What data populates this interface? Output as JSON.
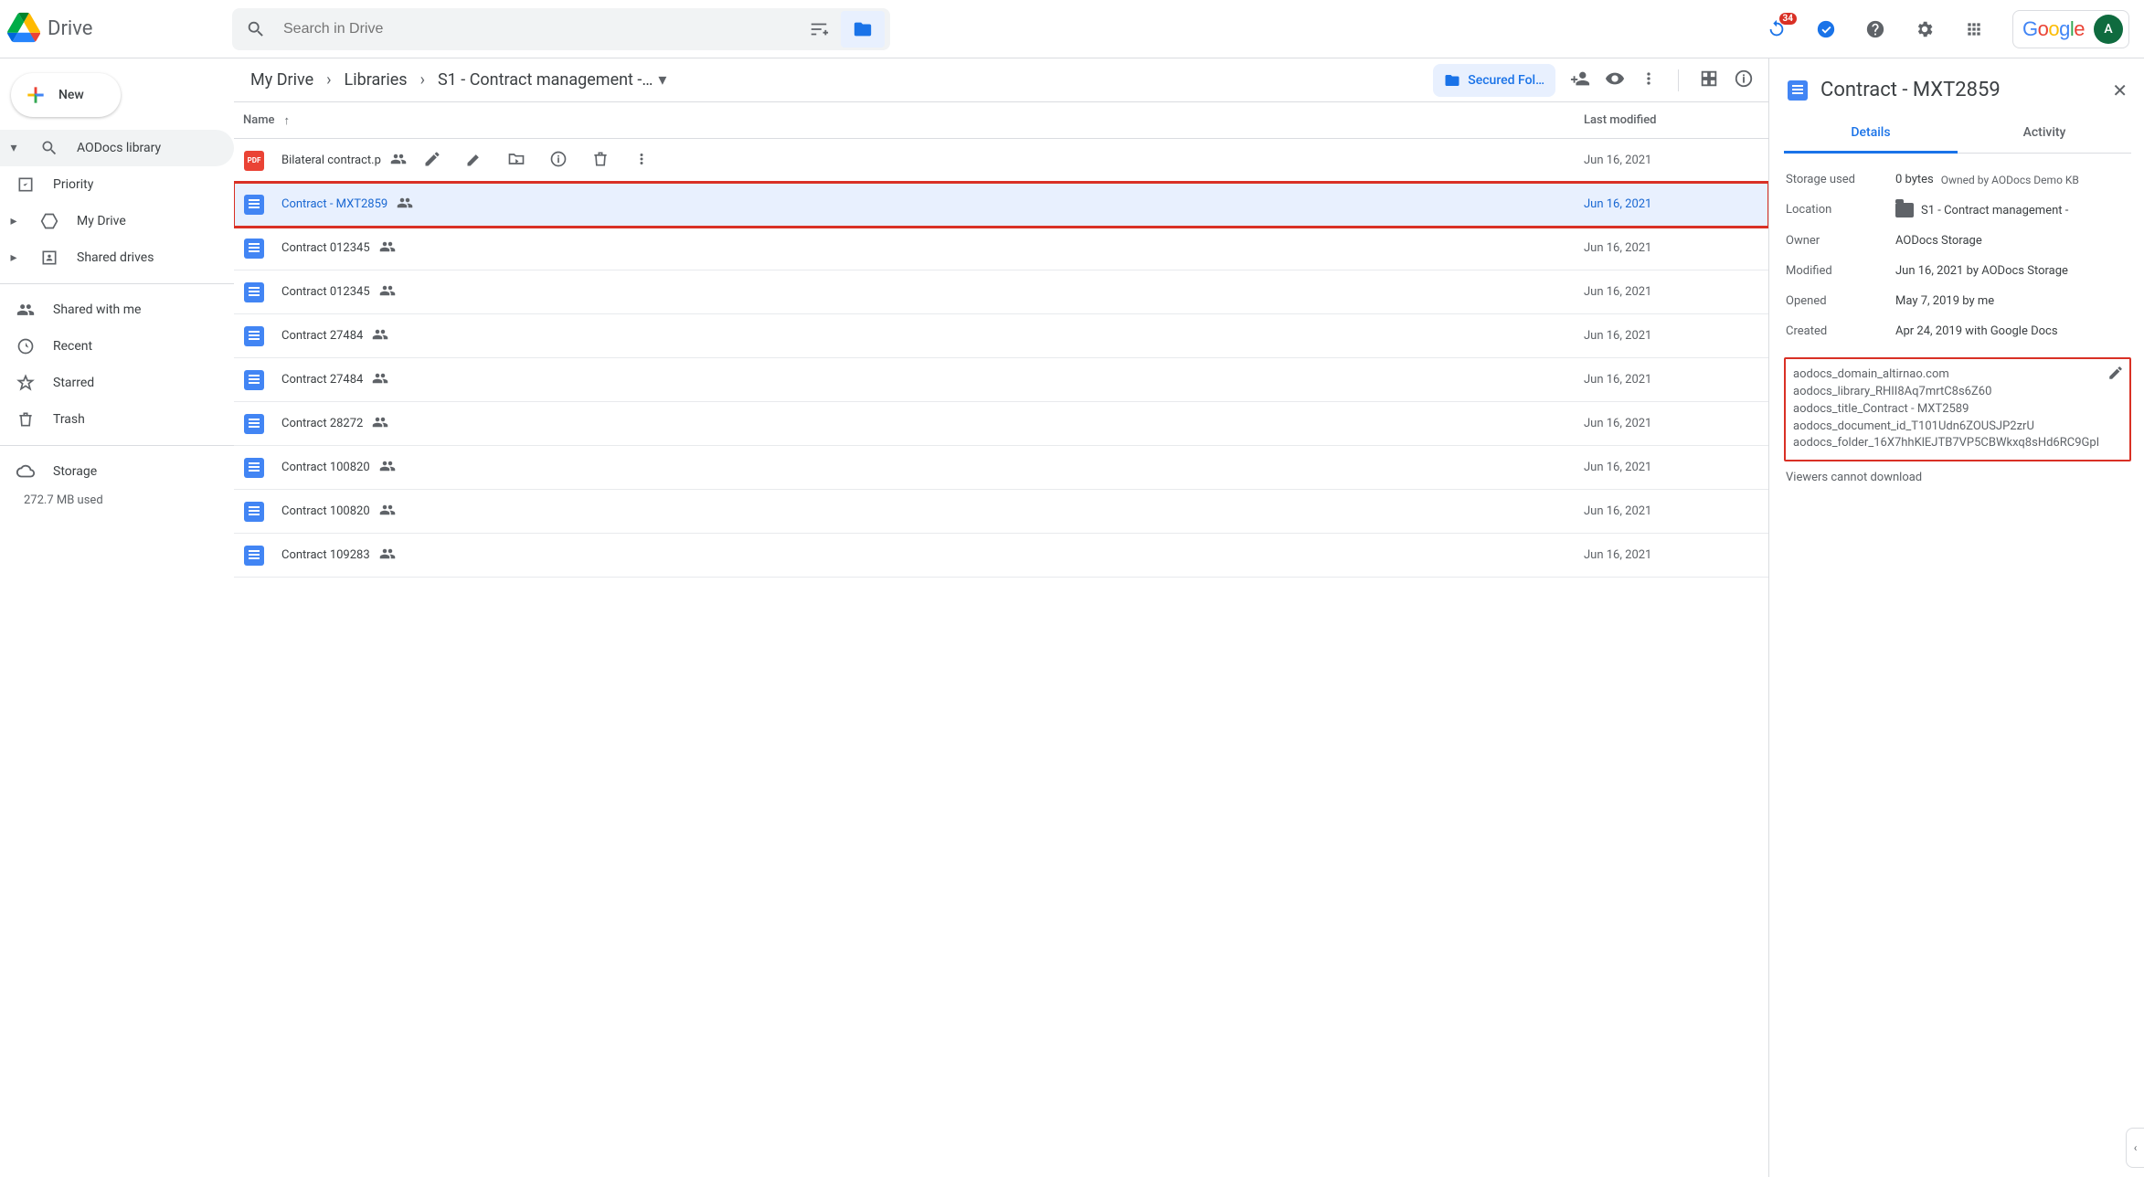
{
  "app": {
    "title": "Drive",
    "google_logo_text": "Google",
    "avatar_initial": "A"
  },
  "search": {
    "placeholder": "Search in Drive"
  },
  "header_badge": "34",
  "sidebar": {
    "new_label": "New",
    "items": [
      {
        "label": "AODocs library",
        "active": true,
        "expand": true,
        "icon": "search-icon"
      },
      {
        "label": "Priority",
        "icon": "priority-icon"
      },
      {
        "label": "My Drive",
        "expandable": true,
        "icon": "mydrive-icon"
      },
      {
        "label": "Shared drives",
        "expandable": true,
        "icon": "shared-drives-icon"
      }
    ],
    "items2": [
      {
        "label": "Shared with me",
        "icon": "shared-with-me-icon"
      },
      {
        "label": "Recent",
        "icon": "recent-icon"
      },
      {
        "label": "Starred",
        "icon": "star-icon"
      },
      {
        "label": "Trash",
        "icon": "trash-icon"
      }
    ],
    "storage_label": "Storage",
    "storage_used": "272.7 MB used"
  },
  "breadcrumbs": {
    "a": "My Drive",
    "b": "Libraries",
    "c": "S1 - Contract management -…"
  },
  "secured_pill": "Secured Fol…",
  "columns": {
    "name": "Name",
    "modified": "Last modified"
  },
  "files": [
    {
      "name": "Bilateral contract.p",
      "date": "Jun 16, 2021",
      "type": "pdf",
      "has_actions": true
    },
    {
      "name": "Contract - MXT2859",
      "date": "Jun 16, 2021",
      "type": "doc",
      "selected": true
    },
    {
      "name": "Contract 012345",
      "date": "Jun 16, 2021",
      "type": "doc"
    },
    {
      "name": "Contract 012345",
      "date": "Jun 16, 2021",
      "type": "doc"
    },
    {
      "name": "Contract 27484",
      "date": "Jun 16, 2021",
      "type": "doc"
    },
    {
      "name": "Contract 27484",
      "date": "Jun 16, 2021",
      "type": "doc"
    },
    {
      "name": "Contract 28272",
      "date": "Jun 16, 2021",
      "type": "doc"
    },
    {
      "name": "Contract 100820",
      "date": "Jun 16, 2021",
      "type": "doc"
    },
    {
      "name": "Contract 100820",
      "date": "Jun 16, 2021",
      "type": "doc"
    },
    {
      "name": "Contract 109283",
      "date": "Jun 16, 2021",
      "type": "doc"
    }
  ],
  "details": {
    "title": "Contract - MXT2859",
    "tabs": {
      "details": "Details",
      "activity": "Activity"
    },
    "props": {
      "storage_used_k": "Storage used",
      "storage_used_v": "0 bytes",
      "storage_used_note": "Owned by AODocs Demo KB",
      "location_k": "Location",
      "location_v": "S1 - Contract management -",
      "owner_k": "Owner",
      "owner_v": "AODocs Storage",
      "modified_k": "Modified",
      "modified_v": "Jun 16, 2021 by AODocs Storage",
      "opened_k": "Opened",
      "opened_v": "May 7, 2019 by me",
      "created_k": "Created",
      "created_v": "Apr 24, 2019 with Google Docs"
    },
    "description": "aodocs_domain_altirnao.com\naodocs_library_RHII8Aq7mrtC8s6Z60\naodocs_title_Contract - MXT2589\naodocs_document_id_T101Udn6ZOUSJP2zrU\naodocs_folder_16X7hhKlEJTB7VP5CBWkxq8sHd6RC9GpI",
    "footer": "Viewers cannot download"
  }
}
